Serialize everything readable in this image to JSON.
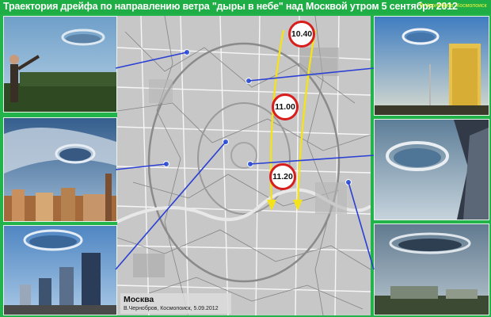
{
  "header": {
    "title": "Траектория дрейфа по направлению ветра \"дыры в небе\"  над Москвой утром 5 сентября 2012",
    "credit": "В.Чернобров, Космопоиск"
  },
  "map": {
    "city_label": "Москва",
    "credit": "В.Чернобров, Космопоиск, 5.09.2012"
  },
  "time_markers": [
    {
      "label": "10.40"
    },
    {
      "label": "11.00"
    },
    {
      "label": "11.20"
    }
  ],
  "colors": {
    "background": "#22b34a",
    "trajectory_arrow": "#f4e21c",
    "connector_line": "#2a3fd4",
    "marker_border": "#d81d1d",
    "title_text": "#ffffff",
    "credit_text": "#f2f23c"
  },
  "photos": [
    {
      "name": "photo-man-pointing"
    },
    {
      "name": "photo-city-skyline-hole"
    },
    {
      "name": "photo-moscow-city-towers"
    },
    {
      "name": "photo-tv-tower"
    },
    {
      "name": "photo-cloud-hole-building"
    },
    {
      "name": "photo-wide-cloud-hole"
    }
  ]
}
